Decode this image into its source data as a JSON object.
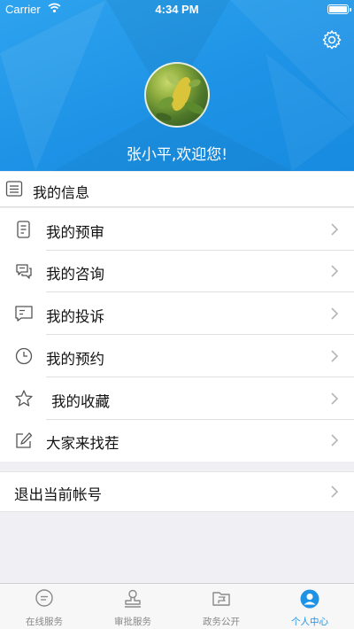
{
  "status_bar": {
    "carrier": "Carrier",
    "time": "4:34 PM"
  },
  "header": {
    "welcome": "张小平,欢迎您!"
  },
  "section": {
    "title": "我的信息"
  },
  "menu": {
    "items": [
      {
        "label": "我的预审",
        "icon": "document-list-icon"
      },
      {
        "label": "我的咨询",
        "icon": "chat-bubbles-icon"
      },
      {
        "label": "我的投诉",
        "icon": "message-lines-icon"
      },
      {
        "label": "我的预约",
        "icon": "clock-icon"
      },
      {
        "label": "我的收藏",
        "icon": "star-icon"
      },
      {
        "label": "大家来找茬",
        "icon": "edit-pencil-icon"
      }
    ]
  },
  "logout": {
    "label": "退出当前帐号"
  },
  "tabbar": {
    "tabs": [
      {
        "label": "在线服务",
        "icon": "chat-bubble-icon"
      },
      {
        "label": "审批服务",
        "icon": "stamp-icon"
      },
      {
        "label": "政务公开",
        "icon": "folder-flag-icon"
      },
      {
        "label": "个人中心",
        "icon": "person-circle-icon"
      }
    ],
    "active_index": 3
  },
  "colors": {
    "brand_blue": "#1e93e6",
    "background": "#efeff4",
    "inactive_tab": "#888888"
  }
}
